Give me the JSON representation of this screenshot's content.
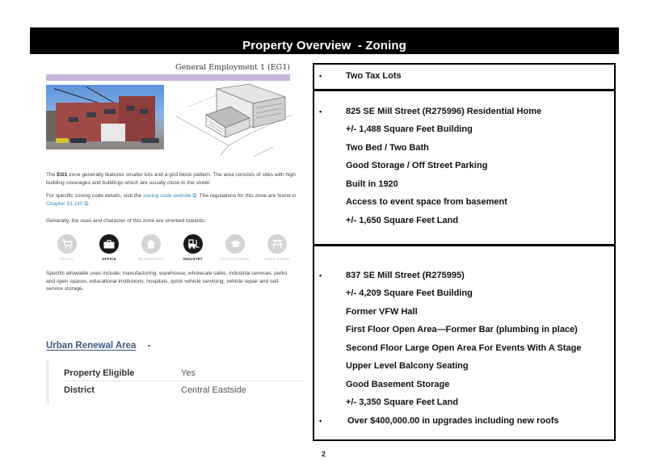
{
  "header": {
    "title": "Property Overview  - Zoning"
  },
  "zoning": {
    "zone_title": "General Employment 1 (EG1)",
    "description_prefix": "The ",
    "description_code": "EG1",
    "description_rest": " zone generally features smaller lots and a grid block pattern. The area consists of sites with high building coverages and buildings which are usually close to the street.",
    "details_prefix": "For specific zoning code details, visit the ",
    "details_link": "zoning code website",
    "details_middle": ". The regulations for this zone are found in ",
    "details_chapter_link": "Chapter 33.140",
    "details_suffix": ".",
    "oriented_text": "Generally, the uses and character of this zone are oriented towards:",
    "uses": [
      {
        "label": "RETAIL",
        "icon": "shopping-cart-icon",
        "active": false
      },
      {
        "label": "OFFICE",
        "icon": "briefcase-icon",
        "active": true
      },
      {
        "label": "RESIDENTIAL",
        "icon": "house-icon",
        "active": false
      },
      {
        "label": "INDUSTRY",
        "icon": "forklift-icon",
        "active": true
      },
      {
        "label": "INSTITUTIONAL",
        "icon": "graduation-cap-icon",
        "active": false
      },
      {
        "label": "OPEN SPACE",
        "icon": "picnic-table-icon",
        "active": false
      }
    ],
    "allowable_uses": "Specific allowable uses include: manufacturing, warehouse, wholesale sales, industrial services, parks and open spaces, educational institutions, hospitals, quick vehicle servicing, vehicle repair and self-service storage."
  },
  "urban_renewal": {
    "title": "Urban Renewal Area",
    "rows": [
      {
        "label": "Property Eligible",
        "value": "Yes"
      },
      {
        "label": "District",
        "value": "Central Eastside"
      }
    ]
  },
  "overview": {
    "section1": [
      {
        "text": "Two Tax Lots",
        "bullet": true
      }
    ],
    "section2": [
      {
        "text": "825 SE Mill Street (R275996) Residential Home",
        "bullet": true
      },
      {
        "text": "+/- 1,488 Square Feet Building",
        "bullet": false
      },
      {
        "text": "Two Bed / Two Bath",
        "bullet": false
      },
      {
        "text": "Good Storage / Off Street Parking",
        "bullet": false
      },
      {
        "text": "Built in 1920",
        "bullet": false
      },
      {
        "text": "Access to event space from basement",
        "bullet": false
      },
      {
        "text": "+/- 1,650 Square Feet Land",
        "bullet": false
      }
    ],
    "section3": [
      {
        "text": "837 SE Mill Street (R275995)",
        "bullet": true
      },
      {
        "text": "+/- 4,209 Square Feet Building",
        "bullet": false
      },
      {
        "text": "Former VFW Hall",
        "bullet": false
      },
      {
        "text": "First Floor Open Area—Former Bar (plumbing in place)",
        "bullet": false
      },
      {
        "text": "Second Floor Large Open Area For Events With A Stage",
        "bullet": false
      },
      {
        "text": "Upper Level Balcony Seating",
        "bullet": false
      },
      {
        "text": "Good Basement Storage",
        "bullet": false
      },
      {
        "text": "+/- 3,350 Square Feet Land",
        "bullet": false
      },
      {
        "text": "Over $400,000.00 in upgrades including new roofs",
        "bullet": true
      }
    ],
    "bullet_char": "•"
  },
  "footer": {
    "page_number": "2"
  },
  "colors": {
    "header_bg": "#000000",
    "zone_accent": "#c9b5d8",
    "link": "#3b8ac4",
    "urban_renewal_title": "#3d5a80"
  }
}
